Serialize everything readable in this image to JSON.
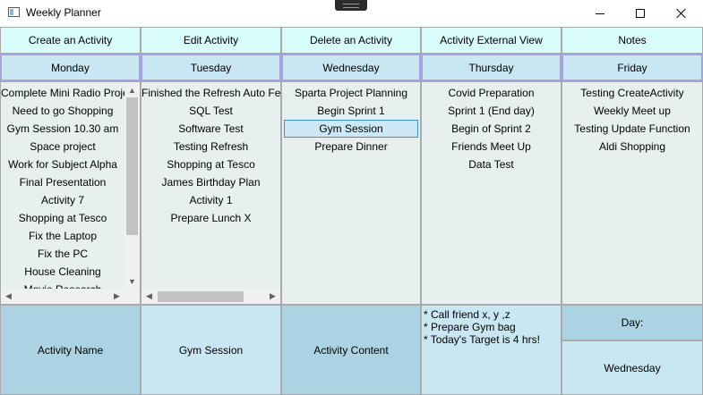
{
  "window": {
    "title": "Weekly Planner",
    "icons": [
      "app-window-icon",
      "minimize-icon",
      "maximize-icon",
      "close-icon"
    ]
  },
  "toolbar": {
    "create": "Create an Activity",
    "edit": "Edit Activity",
    "delete": "Delete an Activity",
    "external": "Activity External View",
    "notes": "Notes"
  },
  "days": [
    "Monday",
    "Tuesday",
    "Wednesday",
    "Thursday",
    "Friday"
  ],
  "lists": {
    "monday": [
      "Complete Mini Radio Project",
      "Need to go Shopping",
      "Gym Session 10.30 am",
      "Space project",
      "Work for Subject Alpha",
      "Final Presentation",
      "Activity 7",
      "Shopping at Tesco",
      "Fix the Laptop",
      "Fix the PC",
      "House Cleaning",
      "Movie Research"
    ],
    "tuesday": [
      "Finished the Refresh Auto Feature",
      "SQL Test",
      "Software Test",
      "Testing Refresh",
      "Shopping at Tesco",
      "James Birthday Plan",
      "Activity 1",
      "Prepare Lunch X"
    ],
    "wednesday": [
      "Sparta Project Planning",
      "Begin Sprint 1",
      "Gym Session",
      "Prepare Dinner"
    ],
    "thursday": [
      "Covid Preparation",
      "Sprint 1 (End day)",
      "Begin of Sprint 2",
      "Friends Meet Up",
      "Data Test"
    ],
    "friday": [
      "Testing CreateActivity",
      "Weekly Meet up",
      "Testing Update Function",
      "Aldi Shopping"
    ]
  },
  "selected": {
    "day": "Wednesday",
    "item": "Gym Session"
  },
  "detail": {
    "name_label": "Activity Name",
    "name_value": "Gym Session",
    "content_label": "Activity Content",
    "content_lines": [
      "* Call friend x, y ,z",
      "* Prepare Gym bag",
      "* Today's Target is 4 hrs!"
    ],
    "day_label": "Day:",
    "day_value": "Wednesday"
  },
  "colors": {
    "button_bg": "#d8fbfb",
    "day_header_bg": "#c8e7f3",
    "day_header_border": "#a8a2dc",
    "list_bg": "#e7f0ee",
    "selection_bg": "#cde8f6",
    "selection_border": "#3c8dc8",
    "bottom_dark": "#acd3e3",
    "bottom_light": "#c8e7f3"
  }
}
